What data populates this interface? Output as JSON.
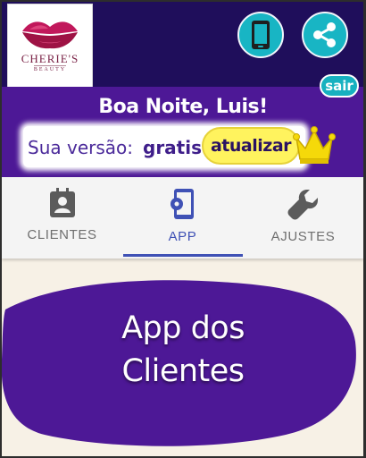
{
  "brand": {
    "name": "CHERIE'S",
    "subtitle": "BEAUTY",
    "lip_colors": {
      "top": "#c1185b",
      "bottom": "#9e1244",
      "highlight": "#e8558a"
    }
  },
  "header": {
    "phone_icon": "smartphone-icon",
    "share_icon": "share-icon",
    "logout_label": "sair",
    "accent_color": "#18b5c4"
  },
  "greeting": "Boa Noite, Luis!",
  "version": {
    "label": "Sua versão:",
    "value": "gratis",
    "update_label": "atualizar",
    "crown_icon": "crown-icon",
    "crown_color": "#f5d90a"
  },
  "tabs": [
    {
      "label": "CLIENTES",
      "icon": "contact-badge-icon",
      "active": false
    },
    {
      "label": "APP",
      "icon": "phone-settings-icon",
      "active": true
    },
    {
      "label": "AJUSTES",
      "icon": "wrench-icon",
      "active": false
    }
  ],
  "hero": {
    "line1": "App dos",
    "line2": "Clientes",
    "blob_color": "#4d1896"
  },
  "colors": {
    "header_bg": "#1f0e5b",
    "band_bg": "#4d1896",
    "active_tab": "#3f51b5",
    "page_bg": "#f7f1e6"
  }
}
